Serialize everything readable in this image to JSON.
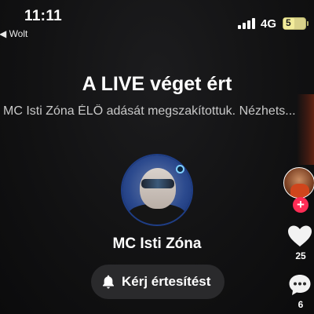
{
  "status_bar": {
    "time": "11:11",
    "back_app": "◀ Wolt",
    "network": "4G",
    "battery": "5",
    "icons": [
      "signal-icon",
      "battery-icon"
    ]
  },
  "live_ended": {
    "title": "A LIVE véget ért",
    "subtitle": "MC Isti Zóna ÉLŐ adását megszakítottuk. Nézhets...",
    "username": "MC Isti Zóna",
    "notify_label": "Kérj értesítést",
    "notify_icon": "bell-icon"
  },
  "actions": {
    "follow_icon": "plus-icon",
    "like_count": "25",
    "like_icon": "heart-icon",
    "comment_count": "6",
    "comment_icon": "comment-icon"
  },
  "colors": {
    "accent": "#fe2c55",
    "background": "#0e0e0f",
    "button": "#2a2a2c"
  }
}
